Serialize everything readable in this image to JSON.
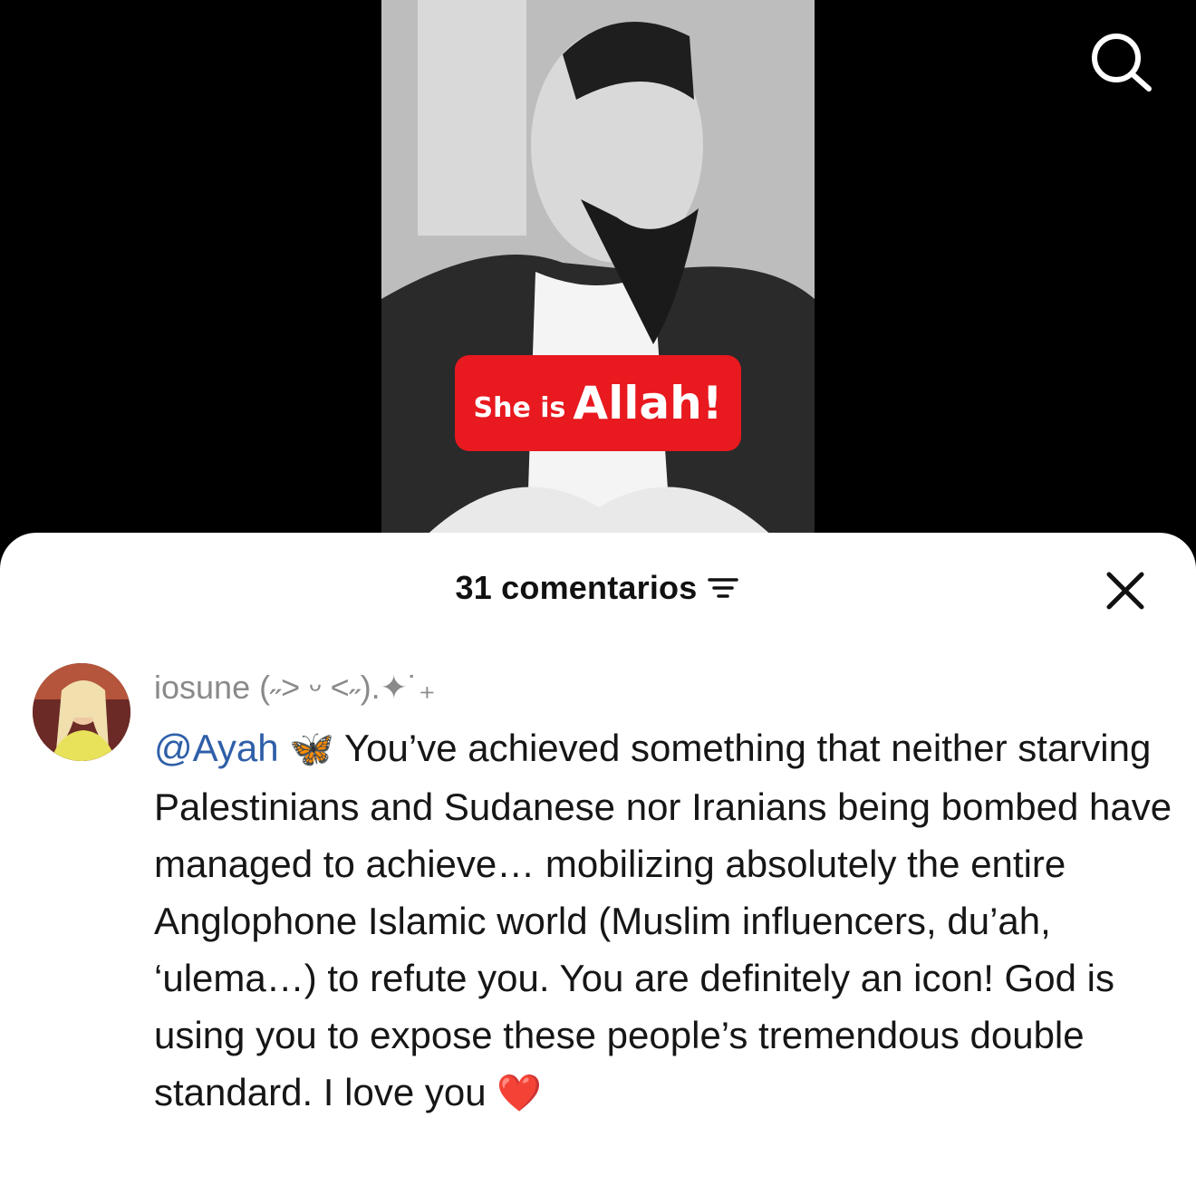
{
  "video": {
    "caption_prefix": "She is",
    "caption_main": "Allah!"
  },
  "comments_sheet": {
    "count_label": "31 comentarios",
    "comment": {
      "username": "iosune (˶˃ ᵕ ˂˶).✦˙₊",
      "mention": "@Ayah",
      "mention_emoji": "🦋",
      "text": " You’ve achieved something that neither starving Palestinians and Sudanese nor Iranians being bombed have managed to achieve… mobilizing absolutely the entire Anglophone Islamic world (Muslim influencers, du’ah, ‘ulema…) to refute you. You are definitely an icon! God is using you to expose these people’s tremendous double standard. I love you ",
      "end_emoji": "❤️"
    }
  },
  "colors": {
    "caption_bg": "#e8191f",
    "mention": "#2f5fa8",
    "username": "#8a8a8a"
  },
  "icons": [
    "search-icon",
    "sort-icon",
    "close-icon",
    "butterfly-emoji",
    "heart-emoji"
  ]
}
